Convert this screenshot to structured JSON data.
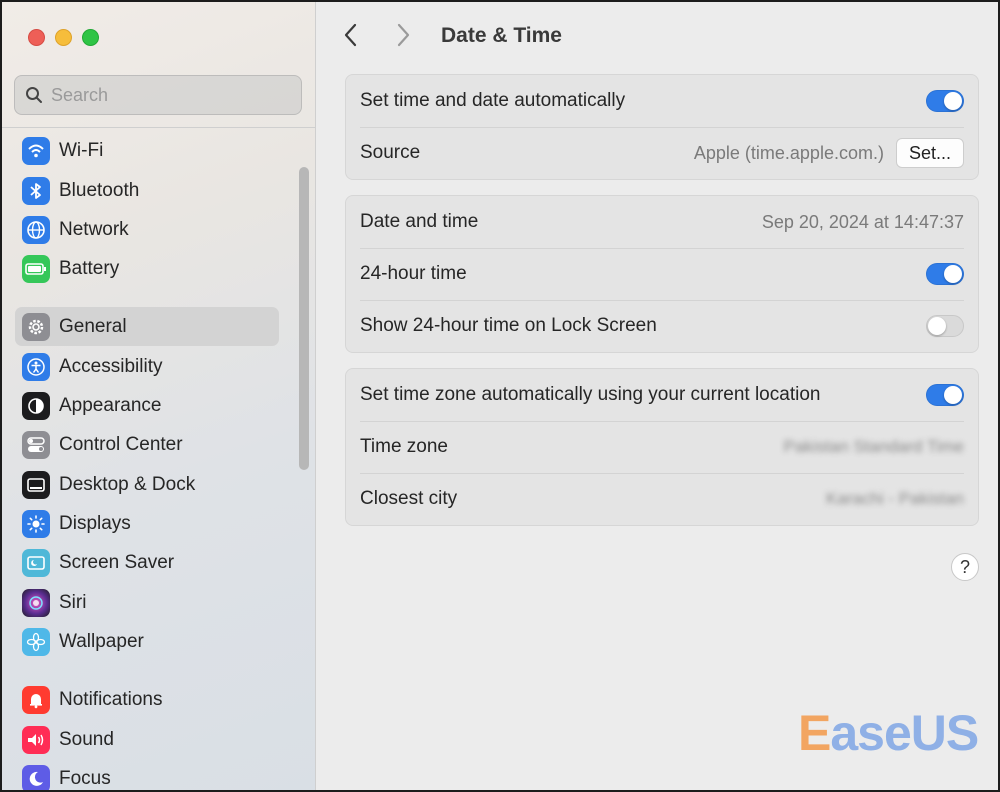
{
  "window": {
    "traffic_lights": [
      "close",
      "minimize",
      "zoom"
    ]
  },
  "sidebar": {
    "search": {
      "placeholder": "Search",
      "value": ""
    },
    "items": [
      {
        "label": "Wi-Fi",
        "icon": "wifi-icon",
        "color": "#2f7ce8"
      },
      {
        "label": "Bluetooth",
        "icon": "bluetooth-icon",
        "color": "#2f7ce8"
      },
      {
        "label": "Network",
        "icon": "globe-icon",
        "color": "#2f7ce8"
      },
      {
        "label": "Battery",
        "icon": "battery-icon",
        "color": "#35c759"
      },
      {
        "label": "General",
        "icon": "gear-icon",
        "color": "#8e8e93",
        "active": true
      },
      {
        "label": "Accessibility",
        "icon": "accessibility-icon",
        "color": "#2f7ce8"
      },
      {
        "label": "Appearance",
        "icon": "appearance-icon",
        "color": "#1c1c1e"
      },
      {
        "label": "Control Center",
        "icon": "control-center-icon",
        "color": "#8e8e93"
      },
      {
        "label": "Desktop & Dock",
        "icon": "dock-icon",
        "color": "#1c1c1e"
      },
      {
        "label": "Displays",
        "icon": "sun-icon",
        "color": "#2f7ce8"
      },
      {
        "label": "Screen Saver",
        "icon": "screen-saver-icon",
        "color": "#4fb8d8"
      },
      {
        "label": "Siri",
        "icon": "siri-icon",
        "color": "#5a2d91"
      },
      {
        "label": "Wallpaper",
        "icon": "flower-icon",
        "color": "#4fb8e8"
      },
      {
        "label": "Notifications",
        "icon": "bell-icon",
        "color": "#ff3b30"
      },
      {
        "label": "Sound",
        "icon": "speaker-icon",
        "color": "#ff2d55"
      },
      {
        "label": "Focus",
        "icon": "moon-icon",
        "color": "#5e5ce6"
      }
    ]
  },
  "header": {
    "back_icon": "chevron-left-icon",
    "forward_icon": "chevron-right-icon",
    "title": "Date & Time"
  },
  "groups": {
    "source": {
      "auto_label": "Set time and date automatically",
      "auto_on": true,
      "source_label": "Source",
      "source_value": "Apple (time.apple.com.)",
      "set_button": "Set..."
    },
    "format": {
      "datetime_label": "Date and time",
      "datetime_value": "Sep 20, 2024 at 14:47:37",
      "hour24_label": "24-hour time",
      "hour24_on": true,
      "lockscreen_label": "Show 24-hour time on Lock Screen",
      "lockscreen_on": false
    },
    "timezone": {
      "auto_label": "Set time zone automatically using your current location",
      "auto_on": true,
      "zone_label": "Time zone",
      "zone_value": "Pakistan Standard Time",
      "city_label": "Closest city",
      "city_value": "Karachi - Pakistan"
    }
  },
  "help_button": "?",
  "watermark": {
    "first": "E",
    "rest": "aseUS",
    "first_color": "#f2a561",
    "rest_color": "#8fb0e6"
  }
}
